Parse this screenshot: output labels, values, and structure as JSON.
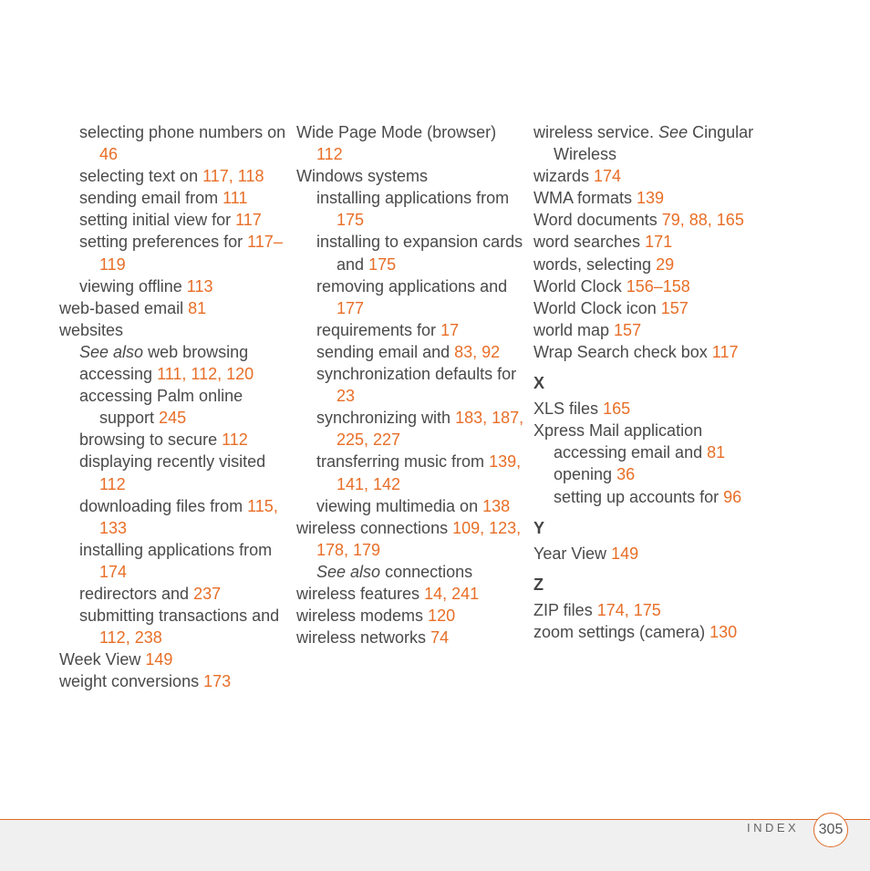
{
  "columns": [
    {
      "entries": [
        {
          "level": 1,
          "text": "selecting phone numbers on",
          "pages": "46"
        },
        {
          "level": 1,
          "text": "selecting text on",
          "pages": "117, 118"
        },
        {
          "level": 1,
          "text": "sending email from",
          "pages": "111"
        },
        {
          "level": 1,
          "text": "setting initial view for",
          "pages": "117"
        },
        {
          "level": 1,
          "text": "setting preferences for",
          "pages": "117–119"
        },
        {
          "level": 1,
          "text": "viewing offline",
          "pages": "113"
        },
        {
          "level": 0,
          "text": "web-based email",
          "pages": "81"
        },
        {
          "level": 0,
          "text": "websites",
          "pages": ""
        },
        {
          "level": 1,
          "see": "See also",
          "text": "web browsing",
          "pages": ""
        },
        {
          "level": 1,
          "text": "accessing",
          "pages": "111, 112, 120"
        },
        {
          "level": 1,
          "text": "accessing Palm online support",
          "pages": "245"
        },
        {
          "level": 1,
          "text": "browsing to secure",
          "pages": "112"
        },
        {
          "level": 1,
          "text": "displaying recently visited",
          "pages": "112"
        },
        {
          "level": 1,
          "text": "downloading files from",
          "pages": "115, 133"
        },
        {
          "level": 1,
          "text": "installing applications from",
          "pages": "174"
        },
        {
          "level": 1,
          "text": "redirectors and",
          "pages": "237"
        },
        {
          "level": 1,
          "text": "submitting transactions and",
          "pages": "112, 238"
        },
        {
          "level": 0,
          "text": "Week View",
          "pages": "149"
        },
        {
          "level": 0,
          "text": "weight conversions",
          "pages": "173"
        }
      ]
    },
    {
      "entries": [
        {
          "level": 0,
          "text": "Wide Page Mode (browser)",
          "pages": "112"
        },
        {
          "level": 0,
          "text": "Windows systems",
          "pages": ""
        },
        {
          "level": 1,
          "text": "installing applications from",
          "pages": "175"
        },
        {
          "level": 1,
          "text": "installing to expansion cards and",
          "pages": "175"
        },
        {
          "level": 1,
          "text": "removing applications and",
          "pages": "177"
        },
        {
          "level": 1,
          "text": "requirements for",
          "pages": "17"
        },
        {
          "level": 1,
          "text": "sending email and",
          "pages": "83, 92"
        },
        {
          "level": 1,
          "text": "synchronization defaults for",
          "pages": "23"
        },
        {
          "level": 1,
          "text": "synchronizing with",
          "pages": "183, 187, 225, 227"
        },
        {
          "level": 1,
          "text": "transferring music from",
          "pages": "139, 141, 142"
        },
        {
          "level": 1,
          "text": "viewing multimedia on",
          "pages": "138"
        },
        {
          "level": 0,
          "text": "wireless connections",
          "pages": "109, 123, 178, 179"
        },
        {
          "level": 1,
          "see": "See also",
          "text": "connections",
          "pages": ""
        },
        {
          "level": 0,
          "text": "wireless features",
          "pages": "14, 241"
        },
        {
          "level": 0,
          "text": "wireless modems",
          "pages": "120"
        },
        {
          "level": 0,
          "text": "wireless networks",
          "pages": "74"
        }
      ]
    },
    {
      "entries": [
        {
          "level": 0,
          "text": "wireless service.",
          "see_after": "See",
          "text2": "Cingular Wireless",
          "pages": ""
        },
        {
          "level": 0,
          "text": "wizards",
          "pages": "174"
        },
        {
          "level": 0,
          "text": "WMA formats",
          "pages": "139"
        },
        {
          "level": 0,
          "text": "Word documents",
          "pages": "79, 88, 165"
        },
        {
          "level": 0,
          "text": "word searches",
          "pages": "171"
        },
        {
          "level": 0,
          "text": "words, selecting",
          "pages": "29"
        },
        {
          "level": 0,
          "text": "World Clock",
          "pages": "156–158"
        },
        {
          "level": 0,
          "text": "World Clock icon",
          "pages": "157"
        },
        {
          "level": 0,
          "text": "world map",
          "pages": "157"
        },
        {
          "level": 0,
          "text": "Wrap Search check box",
          "pages": "117"
        },
        {
          "letter": "X"
        },
        {
          "level": 0,
          "text": "XLS files",
          "pages": "165"
        },
        {
          "level": 0,
          "text": "Xpress Mail application",
          "pages": ""
        },
        {
          "level": 1,
          "text": "accessing email and",
          "pages": "81"
        },
        {
          "level": 1,
          "text": "opening",
          "pages": "36"
        },
        {
          "level": 1,
          "text": "setting up accounts for",
          "pages": "96"
        },
        {
          "letter": "Y"
        },
        {
          "level": 0,
          "text": "Year View",
          "pages": "149"
        },
        {
          "letter": "Z"
        },
        {
          "level": 0,
          "text": "ZIP files",
          "pages": "174, 175"
        },
        {
          "level": 0,
          "text": "zoom settings (camera)",
          "pages": "130"
        }
      ]
    }
  ],
  "footer": {
    "section_label": "INDEX",
    "page_number": "305"
  },
  "colors": {
    "accent": "#e86e27",
    "text": "#4a4a4a",
    "footer_bg": "#f0f0f0"
  }
}
